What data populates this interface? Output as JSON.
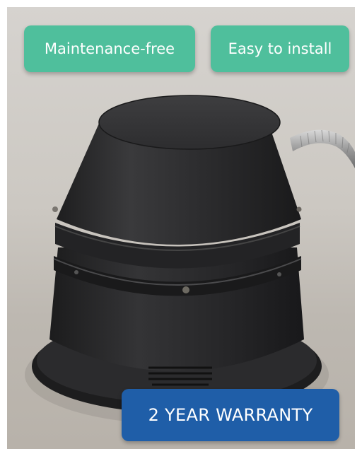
{
  "badges": {
    "maintenance": "Maintenance-free",
    "install": "Easy to install",
    "warranty": "2 YEAR WARRANTY"
  },
  "colors": {
    "green_badge": "#4fbf9c",
    "blue_badge": "#1f5ea8",
    "background": "#d6d3cf",
    "device": "#2a2a2b"
  }
}
